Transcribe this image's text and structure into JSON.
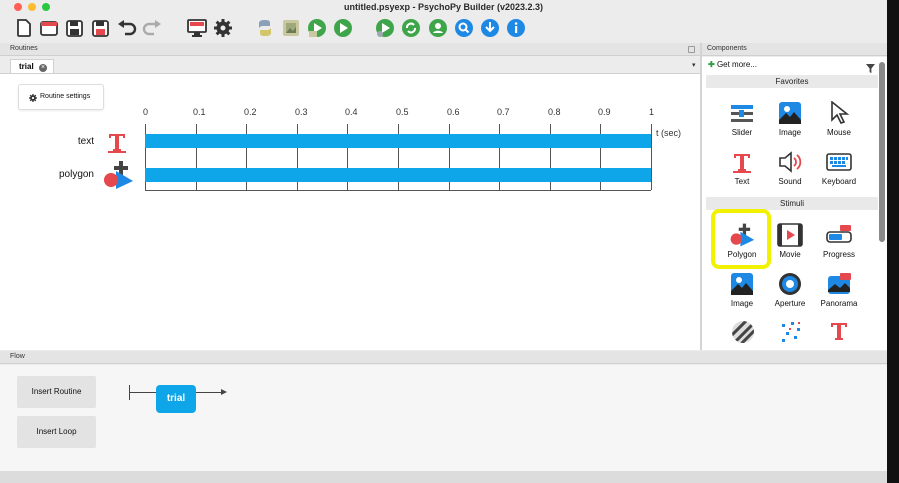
{
  "window": {
    "title": "untitled.psyexp - PsychoPy Builder (v2023.2.3)"
  },
  "toolbar": {
    "buttons": [
      "new-file-icon",
      "open-file-icon",
      "save-icon",
      "save-as-icon",
      "undo-icon",
      "redo-icon",
      "monitor-icon",
      "gear-icon",
      "python-icon",
      "image-file-icon",
      "run-pilot-icon",
      "run-icon",
      "pilot-green-icon",
      "sync-icon",
      "users-icon",
      "search-icon",
      "download-icon",
      "info-icon"
    ]
  },
  "routines": {
    "header": "Routines",
    "tab": "trial",
    "settings_label": "Routine settings",
    "ticks": [
      "0",
      "0.1",
      "0.2",
      "0.3",
      "0.4",
      "0.5",
      "0.6",
      "0.7",
      "0.8",
      "0.9",
      "1"
    ],
    "time_unit": "t (sec)",
    "components": [
      {
        "name": "text",
        "icon": "text-icon"
      },
      {
        "name": "polygon",
        "icon": "polygon-icon"
      }
    ]
  },
  "components": {
    "header": "Components",
    "get_more": "Get more...",
    "favorites_label": "Favorites",
    "favorites": [
      "Slider",
      "Image",
      "Mouse",
      "Text",
      "Sound",
      "Keyboard"
    ],
    "stimuli_label": "Stimuli",
    "stimuli": [
      "Polygon",
      "Movie",
      "Progress",
      "Image",
      "Aperture",
      "Panorama"
    ],
    "highlighted": "Polygon"
  },
  "flow": {
    "header": "Flow",
    "insert_routine": "Insert Routine",
    "insert_loop": "Insert Loop",
    "node": "trial"
  },
  "colors": {
    "accent": "#0ea5e9",
    "highlight": "#f2f200",
    "text_red": "#e5484d"
  }
}
